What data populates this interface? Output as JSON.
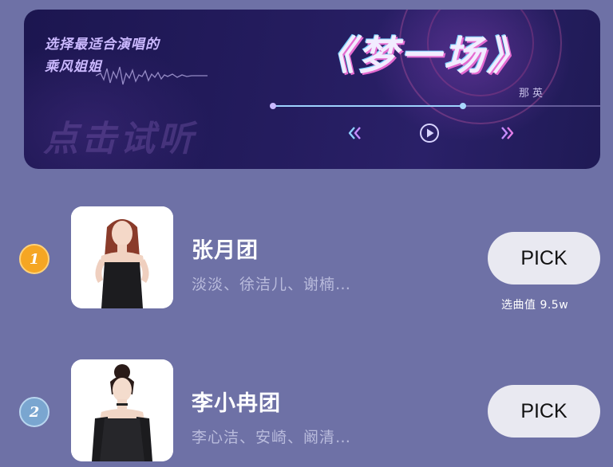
{
  "banner": {
    "tagline_line1": "选择最适合演唱的",
    "tagline_line2": "乘风姐姐",
    "song_title": "《梦一场》",
    "singer": "那英",
    "listen_label": "点击试听",
    "progress": 0.58,
    "controls": {
      "prev_icon": "rewind-icon",
      "play_icon": "play-icon",
      "next_icon": "fast-forward-icon"
    }
  },
  "groups": [
    {
      "rank": "1",
      "rank_color": "#f5a623",
      "name": "张月团",
      "members": "淡淡、徐洁儿、谢楠…",
      "pick_label": "PICK",
      "vote_text": "选曲值 9.5w"
    },
    {
      "rank": "2",
      "rank_color": "#8fb6dd",
      "name": "李小冉团",
      "members": "李心洁、安崎、阚清…",
      "pick_label": "PICK"
    }
  ],
  "colors": {
    "background": "#6e71a6",
    "banner": "#221b5c",
    "button": "#e9e9f1"
  }
}
